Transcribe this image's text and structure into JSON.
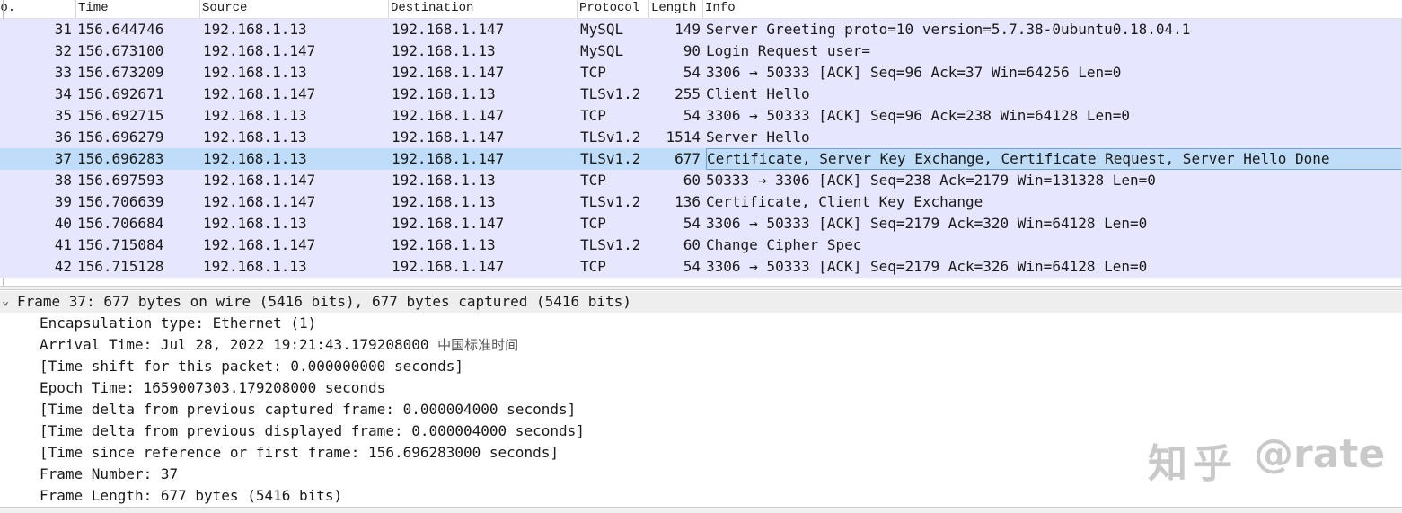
{
  "packet_list": {
    "columns": [
      "No.",
      "Time",
      "Source",
      "Destination",
      "Protocol",
      "Length",
      "Info"
    ],
    "selected_no": "37",
    "rows": [
      {
        "no": "31",
        "time": "156.644746",
        "src": "192.168.1.13",
        "dst": "192.168.1.147",
        "proto": "MySQL",
        "len": "149",
        "info": "Server Greeting  proto=10 version=5.7.38-0ubuntu0.18.04.1"
      },
      {
        "no": "32",
        "time": "156.673100",
        "src": "192.168.1.147",
        "dst": "192.168.1.13",
        "proto": "MySQL",
        "len": "90",
        "info": "Login Request user="
      },
      {
        "no": "33",
        "time": "156.673209",
        "src": "192.168.1.13",
        "dst": "192.168.1.147",
        "proto": "TCP",
        "len": "54",
        "info": "3306 → 50333 [ACK] Seq=96 Ack=37 Win=64256 Len=0"
      },
      {
        "no": "34",
        "time": "156.692671",
        "src": "192.168.1.147",
        "dst": "192.168.1.13",
        "proto": "TLSv1.2",
        "len": "255",
        "info": "Client Hello"
      },
      {
        "no": "35",
        "time": "156.692715",
        "src": "192.168.1.13",
        "dst": "192.168.1.147",
        "proto": "TCP",
        "len": "54",
        "info": "3306 → 50333 [ACK] Seq=96 Ack=238 Win=64128 Len=0"
      },
      {
        "no": "36",
        "time": "156.696279",
        "src": "192.168.1.13",
        "dst": "192.168.1.147",
        "proto": "TLSv1.2",
        "len": "1514",
        "info": "Server Hello"
      },
      {
        "no": "37",
        "time": "156.696283",
        "src": "192.168.1.13",
        "dst": "192.168.1.147",
        "proto": "TLSv1.2",
        "len": "677",
        "info": "Certificate, Server Key Exchange, Certificate Request, Server Hello Done"
      },
      {
        "no": "38",
        "time": "156.697593",
        "src": "192.168.1.147",
        "dst": "192.168.1.13",
        "proto": "TCP",
        "len": "60",
        "info": "50333 → 3306 [ACK] Seq=238 Ack=2179 Win=131328 Len=0"
      },
      {
        "no": "39",
        "time": "156.706639",
        "src": "192.168.1.147",
        "dst": "192.168.1.13",
        "proto": "TLSv1.2",
        "len": "136",
        "info": "Certificate, Client Key Exchange"
      },
      {
        "no": "40",
        "time": "156.706684",
        "src": "192.168.1.13",
        "dst": "192.168.1.147",
        "proto": "TCP",
        "len": "54",
        "info": "3306 → 50333 [ACK] Seq=2179 Ack=320 Win=64128 Len=0"
      },
      {
        "no": "41",
        "time": "156.715084",
        "src": "192.168.1.147",
        "dst": "192.168.1.13",
        "proto": "TLSv1.2",
        "len": "60",
        "info": "Change Cipher Spec"
      },
      {
        "no": "42",
        "time": "156.715128",
        "src": "192.168.1.13",
        "dst": "192.168.1.147",
        "proto": "TCP",
        "len": "54",
        "info": "3306 → 50333 [ACK] Seq=2179 Ack=326 Win=64128 Len=0"
      }
    ]
  },
  "details": {
    "frame_summary": "Frame 37: 677 bytes on wire (5416 bits), 677 bytes captured (5416 bits)",
    "encapsulation": "Encapsulation type: Ethernet (1)",
    "arrival_time": "Arrival Time: Jul 28, 2022 19:21:43.179208000",
    "arrival_tz": "中国标准时间",
    "time_shift": "[Time shift for this packet: 0.000000000 seconds]",
    "epoch_time": "Epoch Time: 1659007303.179208000 seconds",
    "delta_captured": "[Time delta from previous captured frame: 0.000004000 seconds]",
    "delta_displayed": "[Time delta from previous displayed frame: 0.000004000 seconds]",
    "since_reference": "[Time since reference or first frame: 156.696283000 seconds]",
    "frame_number": "Frame Number: 37",
    "frame_length": "Frame Length: 677 bytes (5416 bits)"
  },
  "watermark": {
    "cn": "知乎",
    "handle": "@rate"
  },
  "colors": {
    "row_bg": "#e7e6ff",
    "selected_bg": "#bfdcf8",
    "summary_bg": "#eeeeee"
  },
  "icons": {
    "expanded_twisty": "chevron-down-icon"
  }
}
